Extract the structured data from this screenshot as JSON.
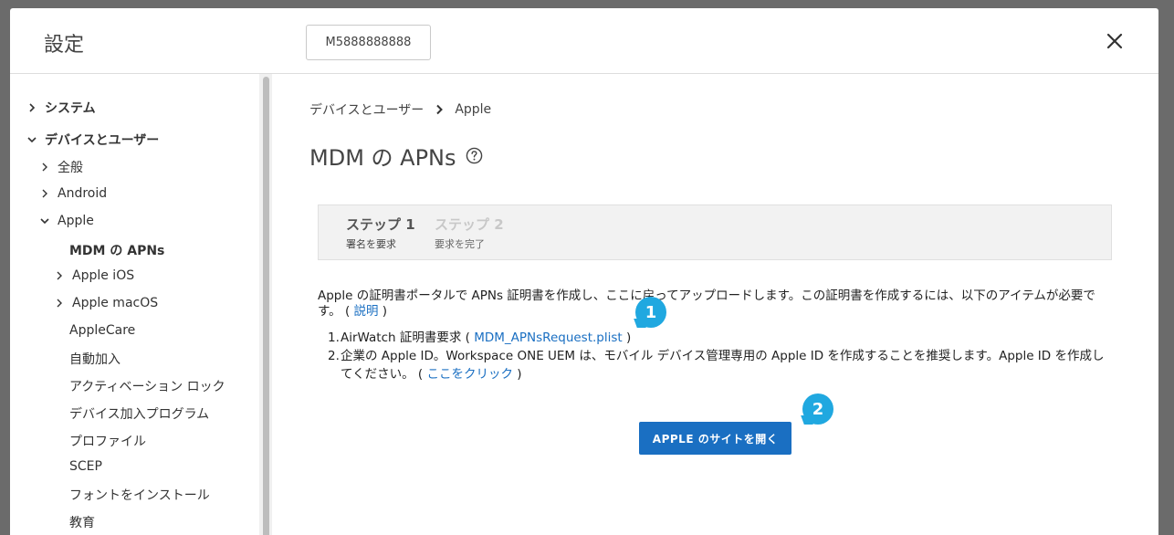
{
  "modal": {
    "title": "設定",
    "org_id": "M5888888888"
  },
  "sidebar": {
    "items": [
      {
        "label": "システム"
      },
      {
        "label": "デバイスとユーザー"
      },
      {
        "label": "全般"
      },
      {
        "label": "Android"
      },
      {
        "label": "Apple"
      },
      {
        "label": "MDM の APNs"
      },
      {
        "label": "Apple iOS"
      },
      {
        "label": "Apple macOS"
      },
      {
        "label": "AppleCare"
      },
      {
        "label": "自動加入"
      },
      {
        "label": "アクティベーション ロック"
      },
      {
        "label": "デバイス加入プログラム"
      },
      {
        "label": "プロファイル"
      },
      {
        "label": "SCEP"
      },
      {
        "label": "フォントをインストール"
      },
      {
        "label": "教育"
      }
    ]
  },
  "breadcrumb": {
    "parent": "デバイスとユーザー",
    "current": "Apple"
  },
  "page": {
    "title": "MDM の APNs"
  },
  "steps": [
    {
      "title": "ステップ 1",
      "subtitle": "署名を要求"
    },
    {
      "title": "ステップ 2",
      "subtitle": "要求を完了"
    }
  ],
  "intro": {
    "text": "Apple の証明書ポータルで APNs 証明書を作成し、ここに戻ってアップロードします。この証明書を作成するには、以下のアイテムが必要です。",
    "paren_open": " ( ",
    "link": "説明",
    "paren_close": " )"
  },
  "requirements": [
    {
      "num": "1.",
      "text": "AirWatch 証明書要求",
      "paren_open": " ( ",
      "link": "MDM_APNsRequest.plist",
      "paren_close": " )"
    },
    {
      "num": "2.",
      "text": "企業の Apple ID。Workspace ONE UEM は、モバイル デバイス管理専用の Apple ID を作成することを推奨します。Apple ID を作成してください。",
      "paren_open": " ( ",
      "link": "ここをクリック",
      "paren_close": " )"
    }
  ],
  "actions": {
    "open_apple_site": "APPLE のサイトを開く"
  },
  "callouts": [
    "1",
    "2"
  ],
  "colors": {
    "accent": "#1a6fc2",
    "callout": "#20a8e0",
    "backdrop": "#6b6b6b"
  }
}
